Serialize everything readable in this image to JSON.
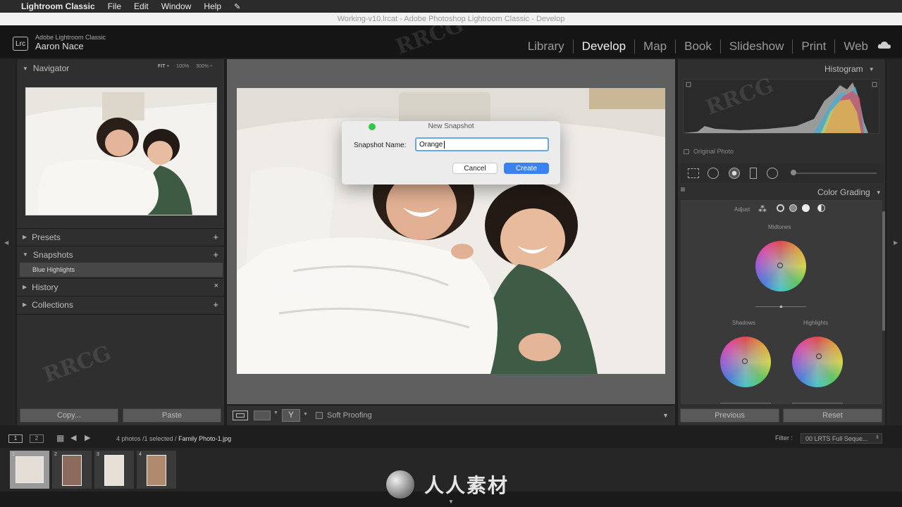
{
  "menubar": {
    "app": "Lightroom Classic",
    "items": [
      "File",
      "Edit",
      "Window",
      "Help"
    ]
  },
  "window": {
    "title": "Working-v10.lrcat - Adobe Photoshop Lightroom Classic - Develop"
  },
  "identity": {
    "logo": "Lrc",
    "product": "Adobe Lightroom Classic",
    "user": "Aaron Nace"
  },
  "modules": [
    "Library",
    "Develop",
    "Map",
    "Book",
    "Slideshow",
    "Print",
    "Web"
  ],
  "left_panel": {
    "navigator": {
      "title": "Navigator",
      "zoom": [
        "FIT ÷",
        "100%",
        "300% ÷"
      ]
    },
    "presets": {
      "title": "Presets",
      "action": "+"
    },
    "snapshots": {
      "title": "Snapshots",
      "action": "+",
      "items": [
        "Blue Highlights"
      ]
    },
    "history": {
      "title": "History",
      "action": "×"
    },
    "collections": {
      "title": "Collections",
      "action": "+"
    },
    "copy_label": "Copy...",
    "paste_label": "Paste"
  },
  "dialog": {
    "title": "New Snapshot",
    "field_label": "Snapshot Name:",
    "field_value": "Orange",
    "cancel": "Cancel",
    "create": "Create"
  },
  "toolbar": {
    "soft_proofing": "Soft Proofing"
  },
  "right_panel": {
    "histogram": {
      "title": "Histogram",
      "original_photo": "Original Photo"
    },
    "color_grading": {
      "title": "Color Grading",
      "adjust_label": "Adjust",
      "midtones": "Midtones",
      "shadows": "Shadows",
      "highlights": "Highlights"
    },
    "previous_label": "Previous",
    "reset_label": "Reset"
  },
  "filmstrip": {
    "views": [
      "1",
      "2"
    ],
    "summary": "4 photos /1 selected /",
    "filename": "Family Photo-1.jpg",
    "filter_label": "Filter :",
    "filter_value": "00 LRTS Full Seque...",
    "thumbnails": [
      "1",
      "2",
      "3",
      "4"
    ]
  },
  "watermark": {
    "brand": "RRCG",
    "logo_text": "人人素材"
  },
  "colors": {
    "accent_blue": "#3b82f0",
    "traffic_green": "#33c748"
  }
}
